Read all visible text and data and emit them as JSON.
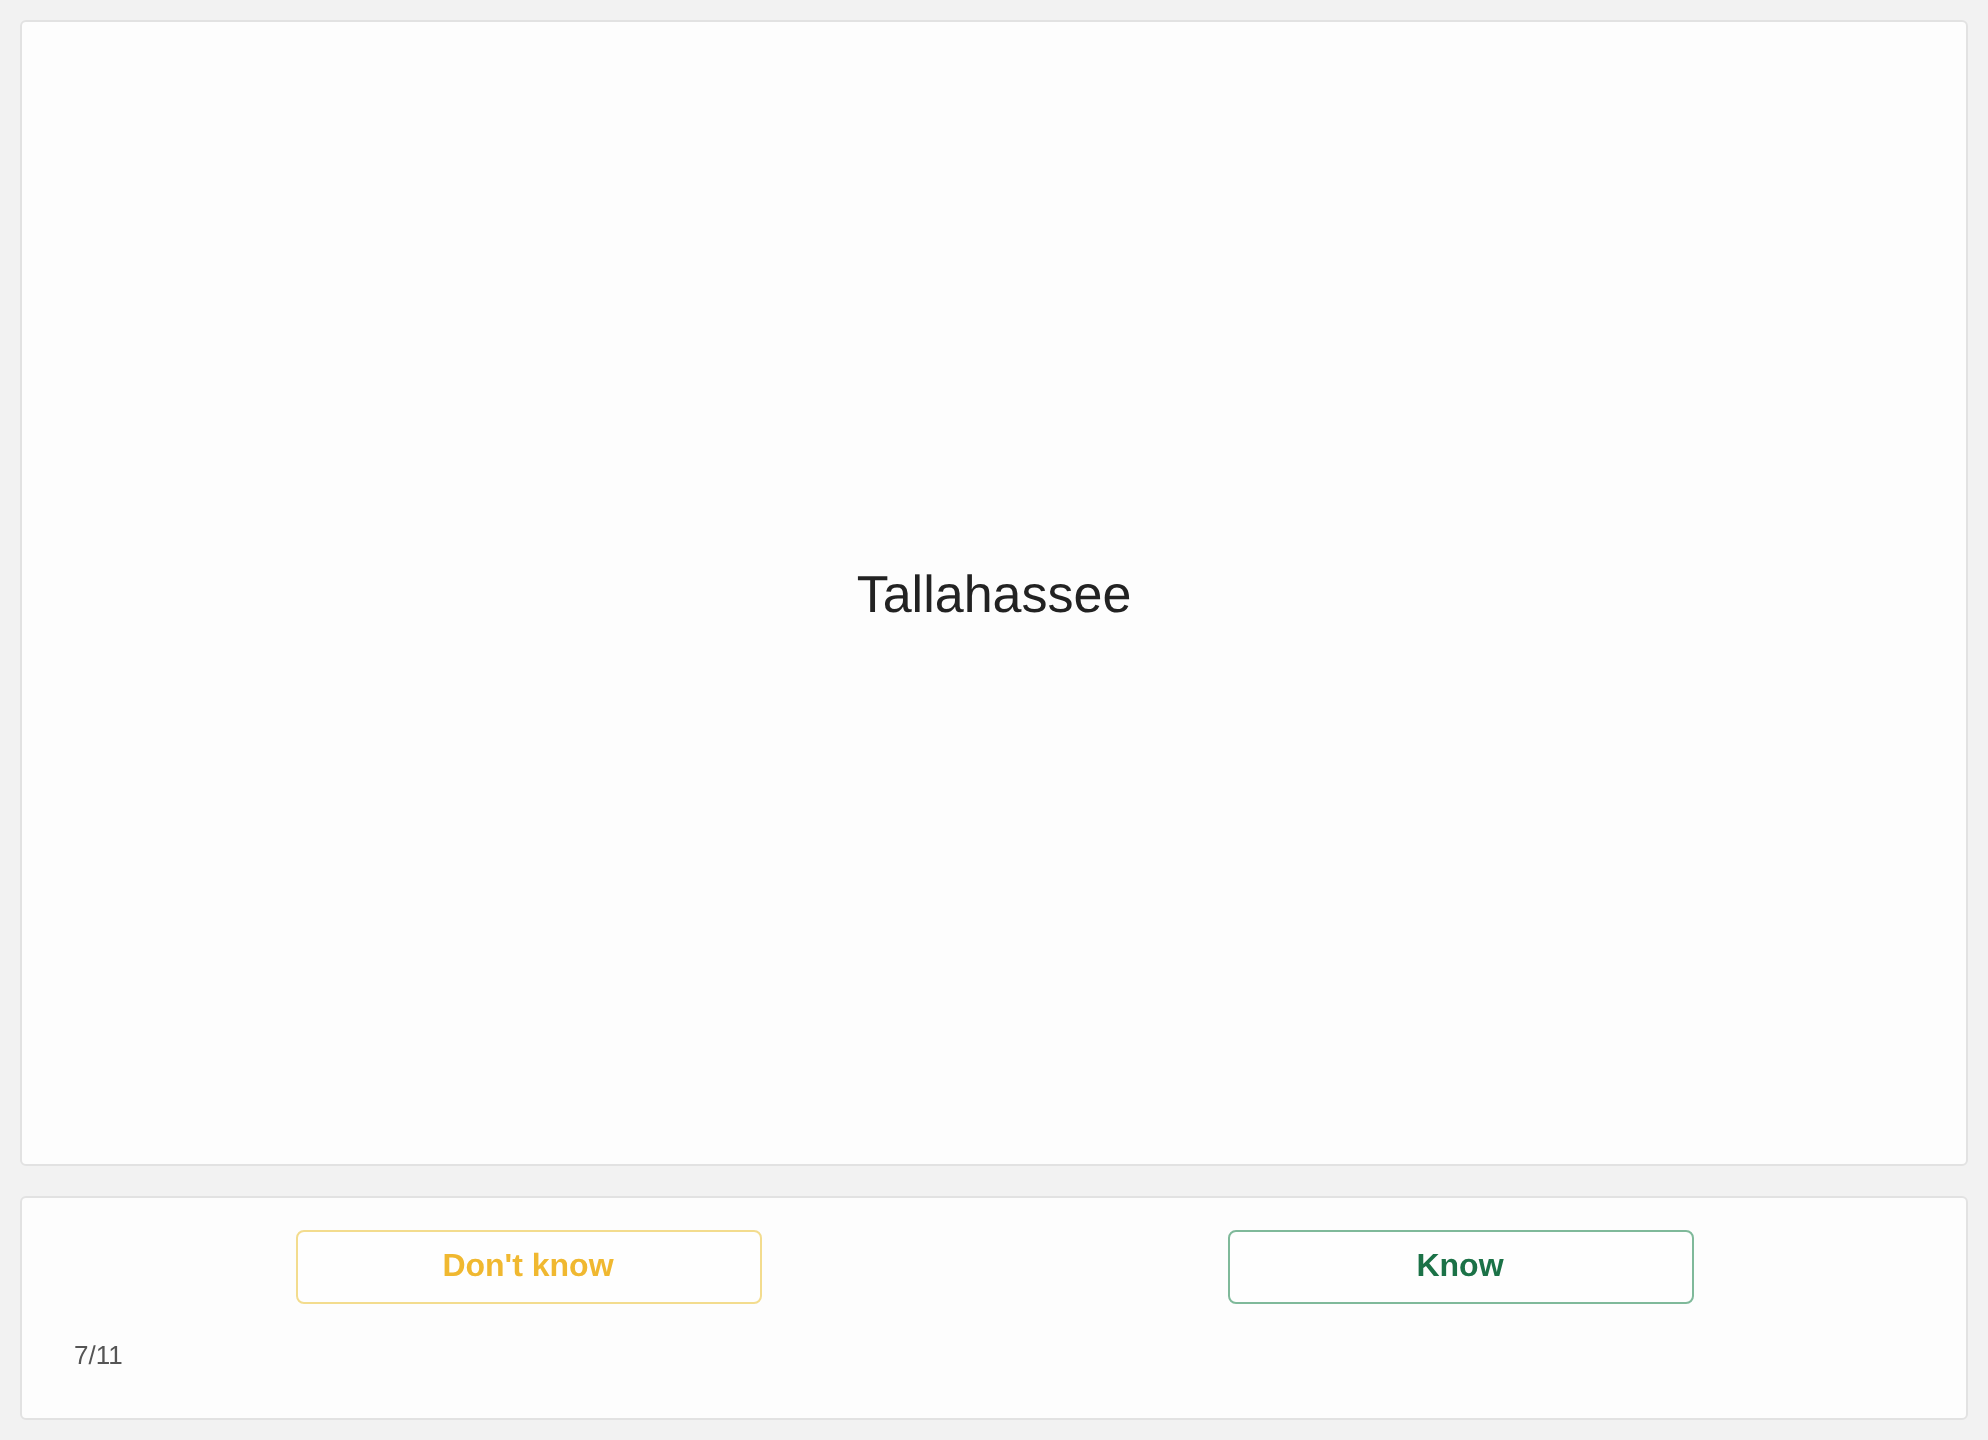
{
  "card": {
    "text": "Tallahassee"
  },
  "buttons": [
    {
      "label": "Don't know",
      "kind": "dont_know"
    },
    {
      "label": "Know",
      "kind": "know"
    }
  ],
  "progress": "7/11"
}
